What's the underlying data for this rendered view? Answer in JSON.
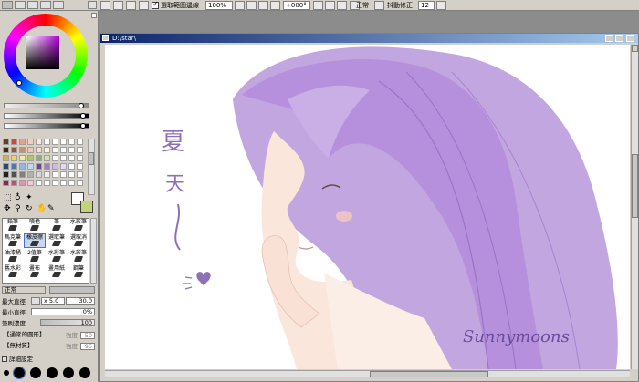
{
  "toolbar": {
    "selection_check_label": "選取範圍邊線",
    "zoom_value": "100%",
    "angle_value": "+000°",
    "blend_mode": "正常",
    "stabilizer_label": "抖動修正",
    "stabilizer_value": "12"
  },
  "canvas_window": {
    "title": "D:\\star\\"
  },
  "tools": {
    "rows": [
      [
        "鉛筆",
        "噴槍",
        "筆",
        "水彩筆"
      ],
      [
        "馬克筆",
        "橡皮擦",
        "選取筆",
        "選取消"
      ],
      [
        "油漆桶",
        "2值筆",
        "水彩筆",
        "水彩筆"
      ],
      [
        "舊水彩",
        "畫布",
        "畫用紙",
        "鋼筆"
      ]
    ]
  },
  "properties": {
    "mode_value": "正常",
    "max_diameter_label": "最大直徑",
    "max_diameter_mult": "x 5.0",
    "max_diameter_value": "30.0",
    "min_diameter_label": "最小直徑",
    "min_diameter_value": "0%",
    "density_label": "筆刷濃度",
    "density_value": "100",
    "shape_label": "【通常的圓形】",
    "shape_strength_label": "強度",
    "shape_strength_value": "50",
    "texture_label": "【無材質】",
    "texture_strength_label": "強度",
    "texture_strength_value": "95",
    "detail_label": "詳細設定"
  },
  "artwork": {
    "calligraphy_text": "夏天~",
    "signature": "Sunnymoons"
  },
  "colors": {
    "hair": "#b89ad8",
    "skin": "#fbe6dc",
    "primary_color": "#ffffff",
    "secondary_color": "#c2d37a"
  }
}
